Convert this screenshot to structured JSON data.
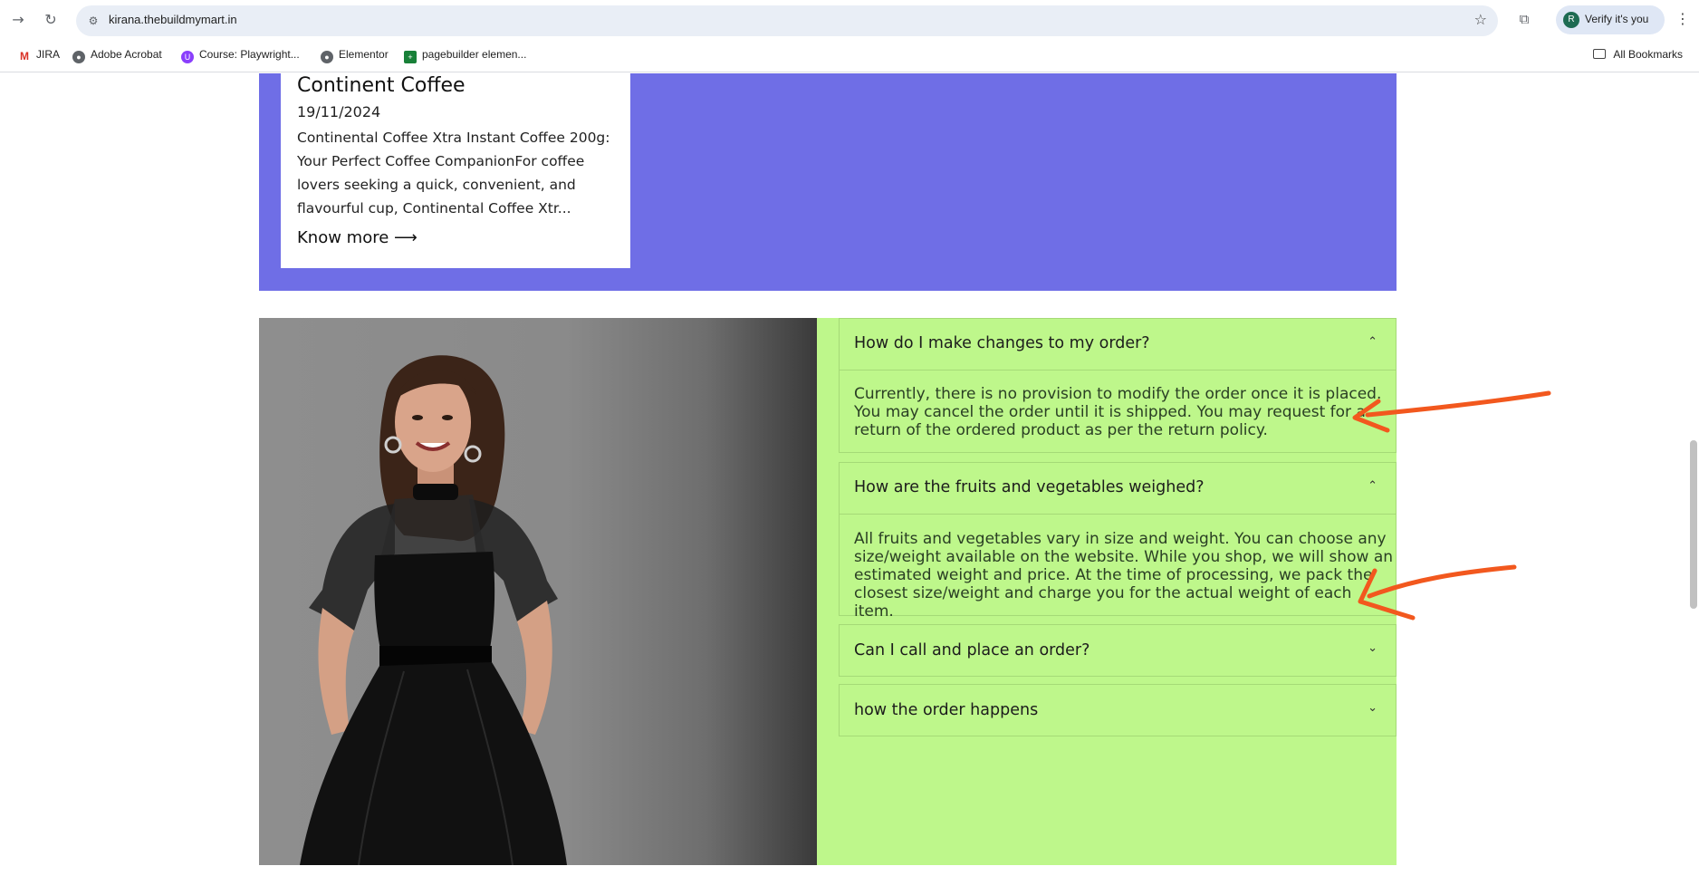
{
  "browser": {
    "url": "kirana.thebuildmymart.in",
    "verify_label": "Verify it's you",
    "avatar_letter": "R",
    "bookmarks": [
      {
        "label": "JIRA"
      },
      {
        "label": "Adobe Acrobat"
      },
      {
        "label": "Course: Playwright..."
      },
      {
        "label": "Elementor"
      },
      {
        "label": "pagebuilder elemen..."
      }
    ],
    "all_bookmarks_label": "All Bookmarks"
  },
  "blog_card": {
    "title": "Continent Coffee",
    "date": "19/11/2024",
    "excerpt": "Continental Coffee Xtra Instant Coffee 200g: Your Perfect Coffee CompanionFor coffee lovers seeking a quick, convenient, and flavourful cup, Continental Coffee Xtr...",
    "link_label": "Know more ⟶"
  },
  "faq": {
    "items": [
      {
        "question": "How do I make changes to my order?",
        "answer": "Currently, there is no provision to modify the order once it is placed. You may cancel the order until it is shipped. You may request for a return of the ordered product as per the return policy.",
        "expanded": true
      },
      {
        "question": "How are the fruits and vegetables weighed?",
        "answer": "All fruits and vegetables vary in size and weight. You can choose any size/weight available on the website. While you shop, we will show an estimated weight and price. At the time of processing, we pack the closest size/weight and charge you for the actual weight of each item.",
        "expanded": true
      },
      {
        "question": "Can I call and place an order?",
        "expanded": false
      },
      {
        "question": "how the order happens",
        "expanded": false
      }
    ]
  },
  "colors": {
    "purple_band": "#6f6ee6",
    "faq_panel": "#bef78b",
    "annotation": "#f2581e"
  }
}
